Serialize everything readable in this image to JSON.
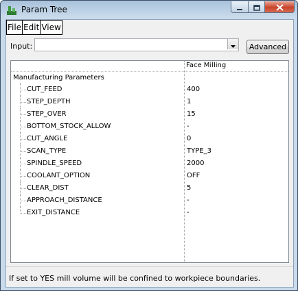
{
  "window": {
    "title": "Param Tree",
    "app_icon": "app-logo-icon"
  },
  "title_controls": {
    "minimize_icon": "minimize-icon",
    "maximize_icon": "maximize-icon",
    "close_icon": "close-icon"
  },
  "menu": {
    "items": [
      {
        "label": "File"
      },
      {
        "label": "Edit"
      },
      {
        "label": "View"
      }
    ]
  },
  "input": {
    "label": "Input:",
    "value": "",
    "dropdown_icon": "chevron-down-icon"
  },
  "advanced_button": {
    "label": "Advanced"
  },
  "tree": {
    "header_value_column": "Face Milling",
    "root": "Manufacturing Parameters",
    "parameters": [
      {
        "name": "CUT_FEED",
        "value": "400"
      },
      {
        "name": "STEP_DEPTH",
        "value": "1"
      },
      {
        "name": "STEP_OVER",
        "value": "15"
      },
      {
        "name": "BOTTOM_STOCK_ALLOW",
        "value": "-"
      },
      {
        "name": "CUT_ANGLE",
        "value": "0"
      },
      {
        "name": "SCAN_TYPE",
        "value": "TYPE_3"
      },
      {
        "name": "SPINDLE_SPEED",
        "value": "2000"
      },
      {
        "name": "COOLANT_OPTION",
        "value": "OFF"
      },
      {
        "name": "CLEAR_DIST",
        "value": "5"
      },
      {
        "name": "APPROACH_DISTANCE",
        "value": "-"
      },
      {
        "name": "EXIT_DISTANCE",
        "value": "-"
      }
    ]
  },
  "status": {
    "text": "If set to YES mill volume will be confined to workpiece boundaries."
  },
  "colors": {
    "title_gradient": "#a9c2db",
    "client_bg": "#f0f0f0",
    "close_button": "#c7442c"
  }
}
